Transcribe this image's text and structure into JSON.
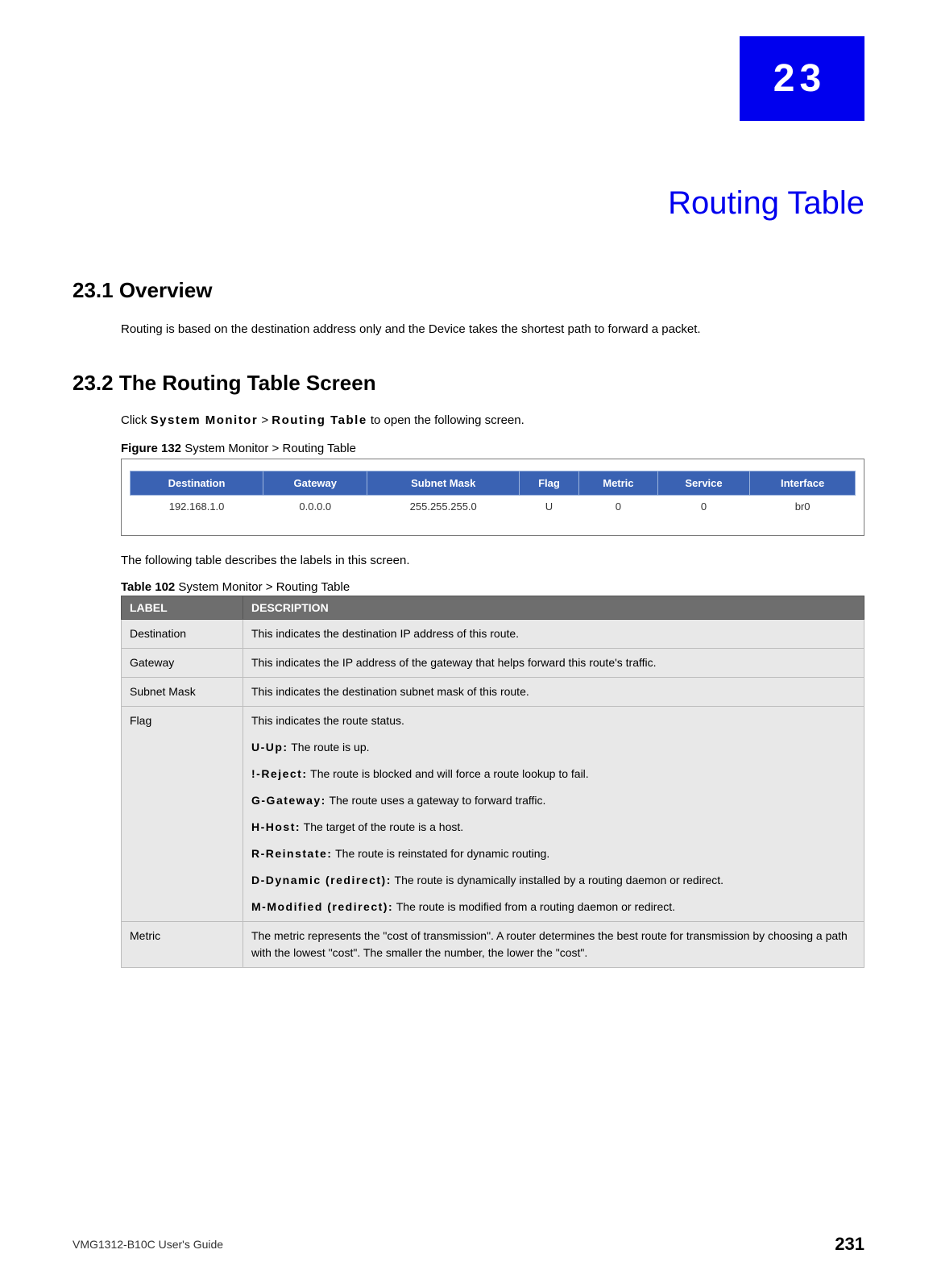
{
  "chapter": {
    "number": "23",
    "title": "Routing Table"
  },
  "sections": {
    "overview": {
      "heading": "23.1  Overview",
      "text": "Routing is based on the destination address only and the Device takes the shortest path to forward a packet."
    },
    "screen": {
      "heading": "23.2  The Routing Table Screen",
      "click_pre": "Click ",
      "click_bold1": "System Monitor",
      "click_mid": " > ",
      "click_bold2": "Routing Table",
      "click_post": " to open the following screen.",
      "figure_label": "Figure 132",
      "figure_title": "   System Monitor > Routing Table",
      "routing_headers": [
        "Destination",
        "Gateway",
        "Subnet Mask",
        "Flag",
        "Metric",
        "Service",
        "Interface"
      ],
      "routing_row": [
        "192.168.1.0",
        "0.0.0.0",
        "255.255.255.0",
        "U",
        "0",
        "0",
        "br0"
      ],
      "desc_intro": "The following table describes the labels in this screen.",
      "table_label": "Table 102",
      "table_title": "   System Monitor > Routing Table",
      "col_label": "LABEL",
      "col_desc": "DESCRIPTION",
      "rows": {
        "destination": {
          "label": "Destination",
          "desc": "This indicates the destination IP address of this route."
        },
        "gateway": {
          "label": "Gateway",
          "desc": "This indicates the IP address of the gateway that helps forward this route's traffic."
        },
        "subnet": {
          "label": "Subnet Mask",
          "desc": "This indicates the destination subnet mask of this route."
        },
        "flag": {
          "label": "Flag",
          "intro": "This indicates the route status.",
          "u_b": "U-Up:",
          "u_t": " The route is up.",
          "ex_b": "!-Reject:",
          "ex_t": " The route is blocked and will force a route lookup to fail.",
          "g_b": "G-Gateway:",
          "g_t": " The route uses a gateway to forward traffic.",
          "h_b": "H-Host:",
          "h_t": " The target of the route is a host.",
          "r_b": "R-Reinstate:",
          "r_t": " The route is reinstated for dynamic routing.",
          "d_b": "D-Dynamic (redirect):",
          "d_t": " The route is dynamically installed by a routing daemon or redirect.",
          "m_b": "M-Modified (redirect):",
          "m_t": " The route is modified from a routing daemon or redirect."
        },
        "metric": {
          "label": "Metric",
          "desc": "The metric represents the \"cost of transmission\". A router determines the best route for transmission by choosing a path with the lowest \"cost\". The smaller the number, the lower the \"cost\"."
        }
      }
    }
  },
  "footer": {
    "guide": "VMG1312-B10C User's Guide",
    "page": "231"
  }
}
